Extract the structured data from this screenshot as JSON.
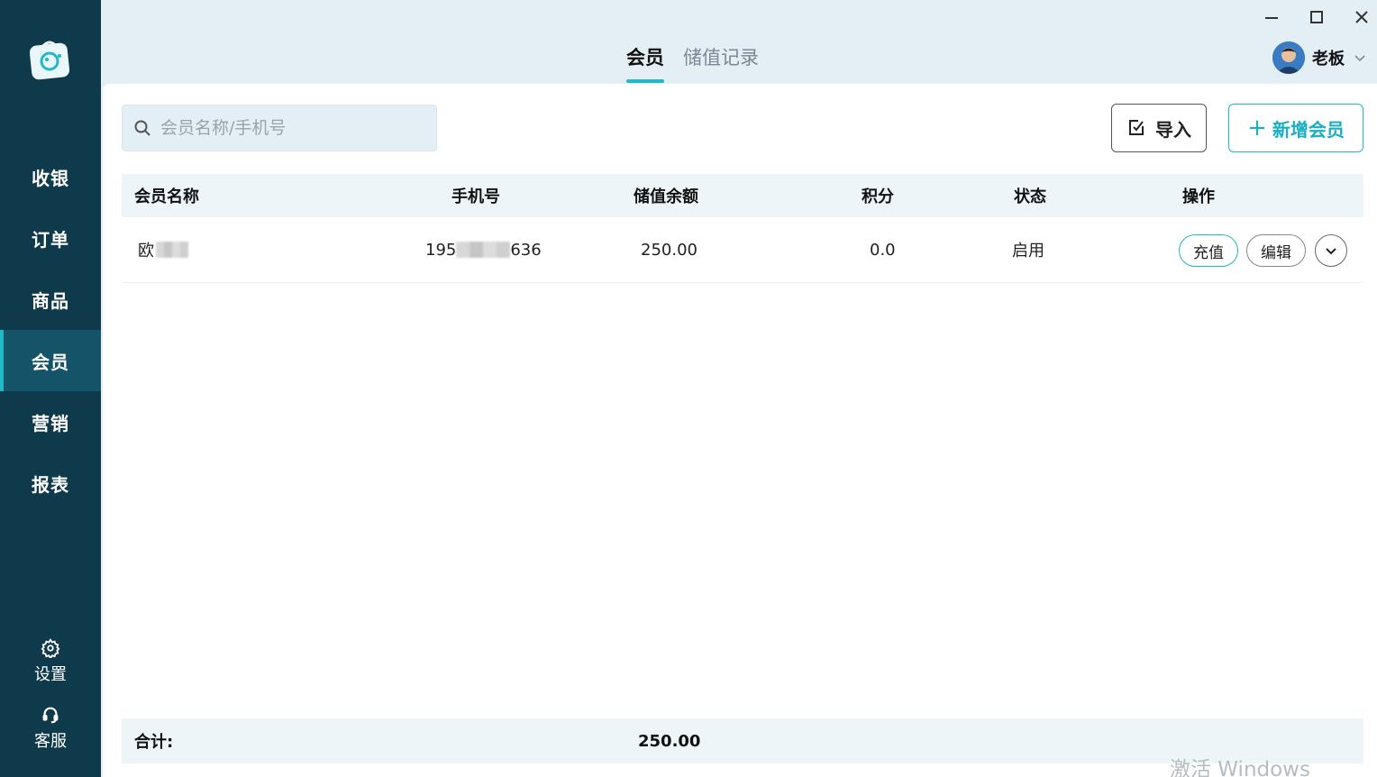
{
  "sidebar": {
    "items": [
      {
        "label": "收银",
        "active": false
      },
      {
        "label": "订单",
        "active": false
      },
      {
        "label": "商品",
        "active": false
      },
      {
        "label": "会员",
        "active": true
      },
      {
        "label": "营销",
        "active": false
      },
      {
        "label": "报表",
        "active": false
      }
    ],
    "settings_label": "设置",
    "support_label": "客服",
    "accent_color": "#22b8c8",
    "bg_color": "#0f3a4c"
  },
  "header": {
    "tabs": [
      {
        "label": "会员",
        "active": true
      },
      {
        "label": "储值记录",
        "active": false
      }
    ],
    "user_name": "老板"
  },
  "toolbar": {
    "search_placeholder": "会员名称/手机号",
    "import_label": "导入",
    "add_label": "新增会员"
  },
  "table": {
    "columns": [
      "会员名称",
      "手机号",
      "储值余额",
      "积分",
      "状态",
      "操作"
    ],
    "rows": [
      {
        "name": "欧",
        "phone_prefix": "195",
        "phone_suffix": "636",
        "balance": "250.00",
        "points": "0.0",
        "status": "启用",
        "recharge_label": "充值",
        "edit_label": "编辑"
      }
    ]
  },
  "footer": {
    "total_label": "合计:",
    "total_balance": "250.00"
  },
  "watermark": "激活 Windows"
}
